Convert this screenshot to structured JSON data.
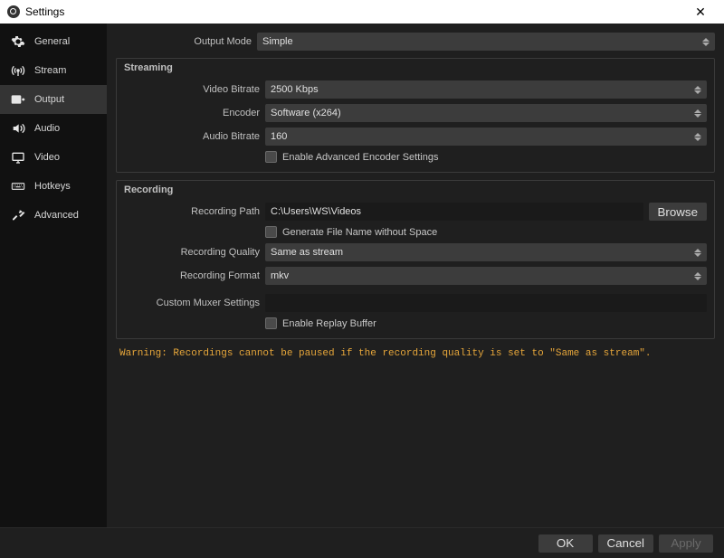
{
  "titlebar": {
    "title": "Settings"
  },
  "sidebar": {
    "items": [
      {
        "label": "General"
      },
      {
        "label": "Stream"
      },
      {
        "label": "Output"
      },
      {
        "label": "Audio"
      },
      {
        "label": "Video"
      },
      {
        "label": "Hotkeys"
      },
      {
        "label": "Advanced"
      }
    ]
  },
  "output_mode": {
    "label": "Output Mode",
    "value": "Simple"
  },
  "streaming": {
    "legend": "Streaming",
    "video_bitrate": {
      "label": "Video Bitrate",
      "value": "2500 Kbps"
    },
    "encoder": {
      "label": "Encoder",
      "value": "Software (x264)"
    },
    "audio_bitrate": {
      "label": "Audio Bitrate",
      "value": "160"
    },
    "enable_advanced": {
      "label": "Enable Advanced Encoder Settings"
    }
  },
  "recording": {
    "legend": "Recording",
    "path": {
      "label": "Recording Path",
      "value": "C:\\Users\\WS\\Videos",
      "browse": "Browse"
    },
    "gen_no_space": {
      "label": "Generate File Name without Space"
    },
    "quality": {
      "label": "Recording Quality",
      "value": "Same as stream"
    },
    "format": {
      "label": "Recording Format",
      "value": "mkv"
    },
    "muxer": {
      "label": "Custom Muxer Settings",
      "value": ""
    },
    "replay": {
      "label": "Enable Replay Buffer"
    }
  },
  "warning": "Warning: Recordings cannot be paused if the recording quality is set to \"Same as stream\".",
  "footer": {
    "ok": "OK",
    "cancel": "Cancel",
    "apply": "Apply"
  }
}
